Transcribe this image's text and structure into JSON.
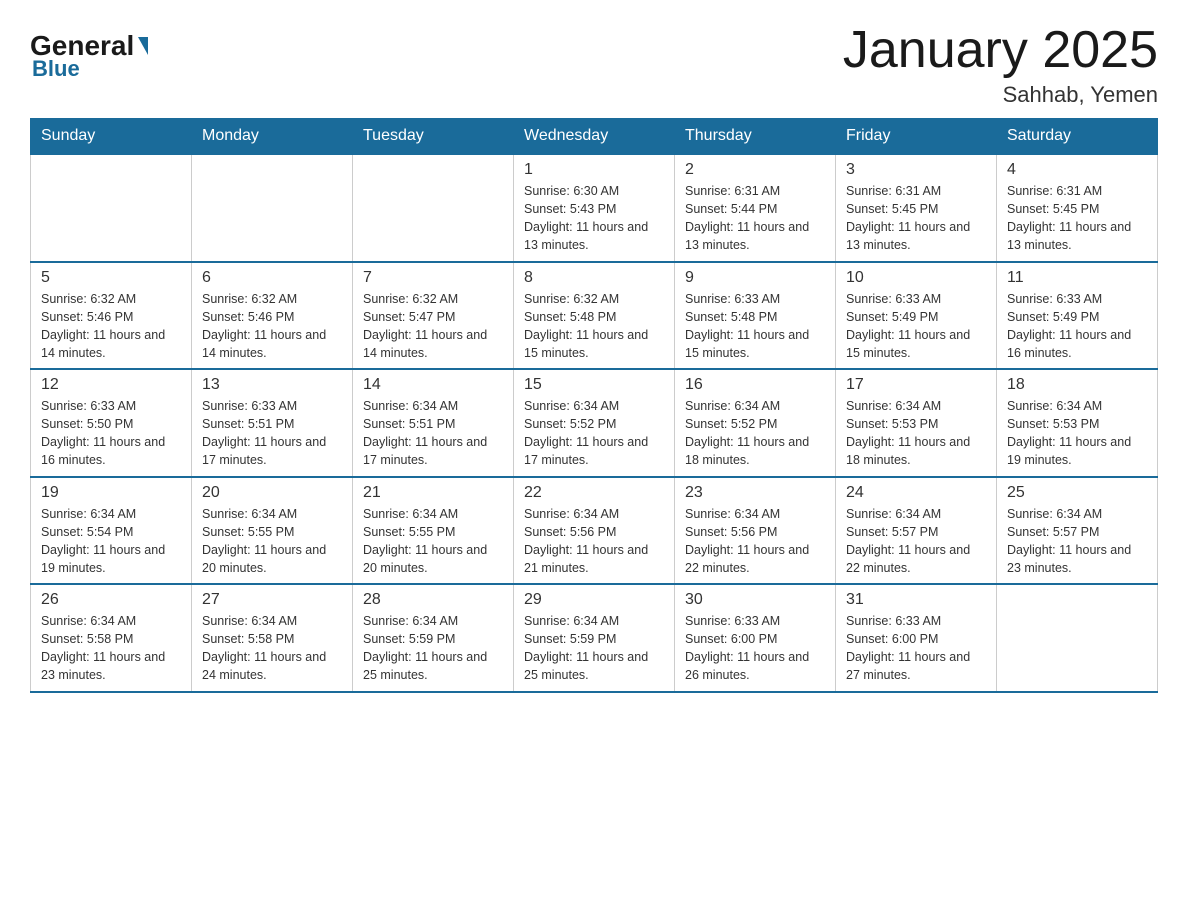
{
  "header": {
    "logo_general": "General",
    "logo_blue": "Blue",
    "month_title": "January 2025",
    "location": "Sahhab, Yemen"
  },
  "days_of_week": [
    "Sunday",
    "Monday",
    "Tuesday",
    "Wednesday",
    "Thursday",
    "Friday",
    "Saturday"
  ],
  "weeks": [
    [
      {
        "day": "",
        "info": ""
      },
      {
        "day": "",
        "info": ""
      },
      {
        "day": "",
        "info": ""
      },
      {
        "day": "1",
        "info": "Sunrise: 6:30 AM\nSunset: 5:43 PM\nDaylight: 11 hours\nand 13 minutes."
      },
      {
        "day": "2",
        "info": "Sunrise: 6:31 AM\nSunset: 5:44 PM\nDaylight: 11 hours\nand 13 minutes."
      },
      {
        "day": "3",
        "info": "Sunrise: 6:31 AM\nSunset: 5:45 PM\nDaylight: 11 hours\nand 13 minutes."
      },
      {
        "day": "4",
        "info": "Sunrise: 6:31 AM\nSunset: 5:45 PM\nDaylight: 11 hours\nand 13 minutes."
      }
    ],
    [
      {
        "day": "5",
        "info": "Sunrise: 6:32 AM\nSunset: 5:46 PM\nDaylight: 11 hours\nand 14 minutes."
      },
      {
        "day": "6",
        "info": "Sunrise: 6:32 AM\nSunset: 5:46 PM\nDaylight: 11 hours\nand 14 minutes."
      },
      {
        "day": "7",
        "info": "Sunrise: 6:32 AM\nSunset: 5:47 PM\nDaylight: 11 hours\nand 14 minutes."
      },
      {
        "day": "8",
        "info": "Sunrise: 6:32 AM\nSunset: 5:48 PM\nDaylight: 11 hours\nand 15 minutes."
      },
      {
        "day": "9",
        "info": "Sunrise: 6:33 AM\nSunset: 5:48 PM\nDaylight: 11 hours\nand 15 minutes."
      },
      {
        "day": "10",
        "info": "Sunrise: 6:33 AM\nSunset: 5:49 PM\nDaylight: 11 hours\nand 15 minutes."
      },
      {
        "day": "11",
        "info": "Sunrise: 6:33 AM\nSunset: 5:49 PM\nDaylight: 11 hours\nand 16 minutes."
      }
    ],
    [
      {
        "day": "12",
        "info": "Sunrise: 6:33 AM\nSunset: 5:50 PM\nDaylight: 11 hours\nand 16 minutes."
      },
      {
        "day": "13",
        "info": "Sunrise: 6:33 AM\nSunset: 5:51 PM\nDaylight: 11 hours\nand 17 minutes."
      },
      {
        "day": "14",
        "info": "Sunrise: 6:34 AM\nSunset: 5:51 PM\nDaylight: 11 hours\nand 17 minutes."
      },
      {
        "day": "15",
        "info": "Sunrise: 6:34 AM\nSunset: 5:52 PM\nDaylight: 11 hours\nand 17 minutes."
      },
      {
        "day": "16",
        "info": "Sunrise: 6:34 AM\nSunset: 5:52 PM\nDaylight: 11 hours\nand 18 minutes."
      },
      {
        "day": "17",
        "info": "Sunrise: 6:34 AM\nSunset: 5:53 PM\nDaylight: 11 hours\nand 18 minutes."
      },
      {
        "day": "18",
        "info": "Sunrise: 6:34 AM\nSunset: 5:53 PM\nDaylight: 11 hours\nand 19 minutes."
      }
    ],
    [
      {
        "day": "19",
        "info": "Sunrise: 6:34 AM\nSunset: 5:54 PM\nDaylight: 11 hours\nand 19 minutes."
      },
      {
        "day": "20",
        "info": "Sunrise: 6:34 AM\nSunset: 5:55 PM\nDaylight: 11 hours\nand 20 minutes."
      },
      {
        "day": "21",
        "info": "Sunrise: 6:34 AM\nSunset: 5:55 PM\nDaylight: 11 hours\nand 20 minutes."
      },
      {
        "day": "22",
        "info": "Sunrise: 6:34 AM\nSunset: 5:56 PM\nDaylight: 11 hours\nand 21 minutes."
      },
      {
        "day": "23",
        "info": "Sunrise: 6:34 AM\nSunset: 5:56 PM\nDaylight: 11 hours\nand 22 minutes."
      },
      {
        "day": "24",
        "info": "Sunrise: 6:34 AM\nSunset: 5:57 PM\nDaylight: 11 hours\nand 22 minutes."
      },
      {
        "day": "25",
        "info": "Sunrise: 6:34 AM\nSunset: 5:57 PM\nDaylight: 11 hours\nand 23 minutes."
      }
    ],
    [
      {
        "day": "26",
        "info": "Sunrise: 6:34 AM\nSunset: 5:58 PM\nDaylight: 11 hours\nand 23 minutes."
      },
      {
        "day": "27",
        "info": "Sunrise: 6:34 AM\nSunset: 5:58 PM\nDaylight: 11 hours\nand 24 minutes."
      },
      {
        "day": "28",
        "info": "Sunrise: 6:34 AM\nSunset: 5:59 PM\nDaylight: 11 hours\nand 25 minutes."
      },
      {
        "day": "29",
        "info": "Sunrise: 6:34 AM\nSunset: 5:59 PM\nDaylight: 11 hours\nand 25 minutes."
      },
      {
        "day": "30",
        "info": "Sunrise: 6:33 AM\nSunset: 6:00 PM\nDaylight: 11 hours\nand 26 minutes."
      },
      {
        "day": "31",
        "info": "Sunrise: 6:33 AM\nSunset: 6:00 PM\nDaylight: 11 hours\nand 27 minutes."
      },
      {
        "day": "",
        "info": ""
      }
    ]
  ]
}
